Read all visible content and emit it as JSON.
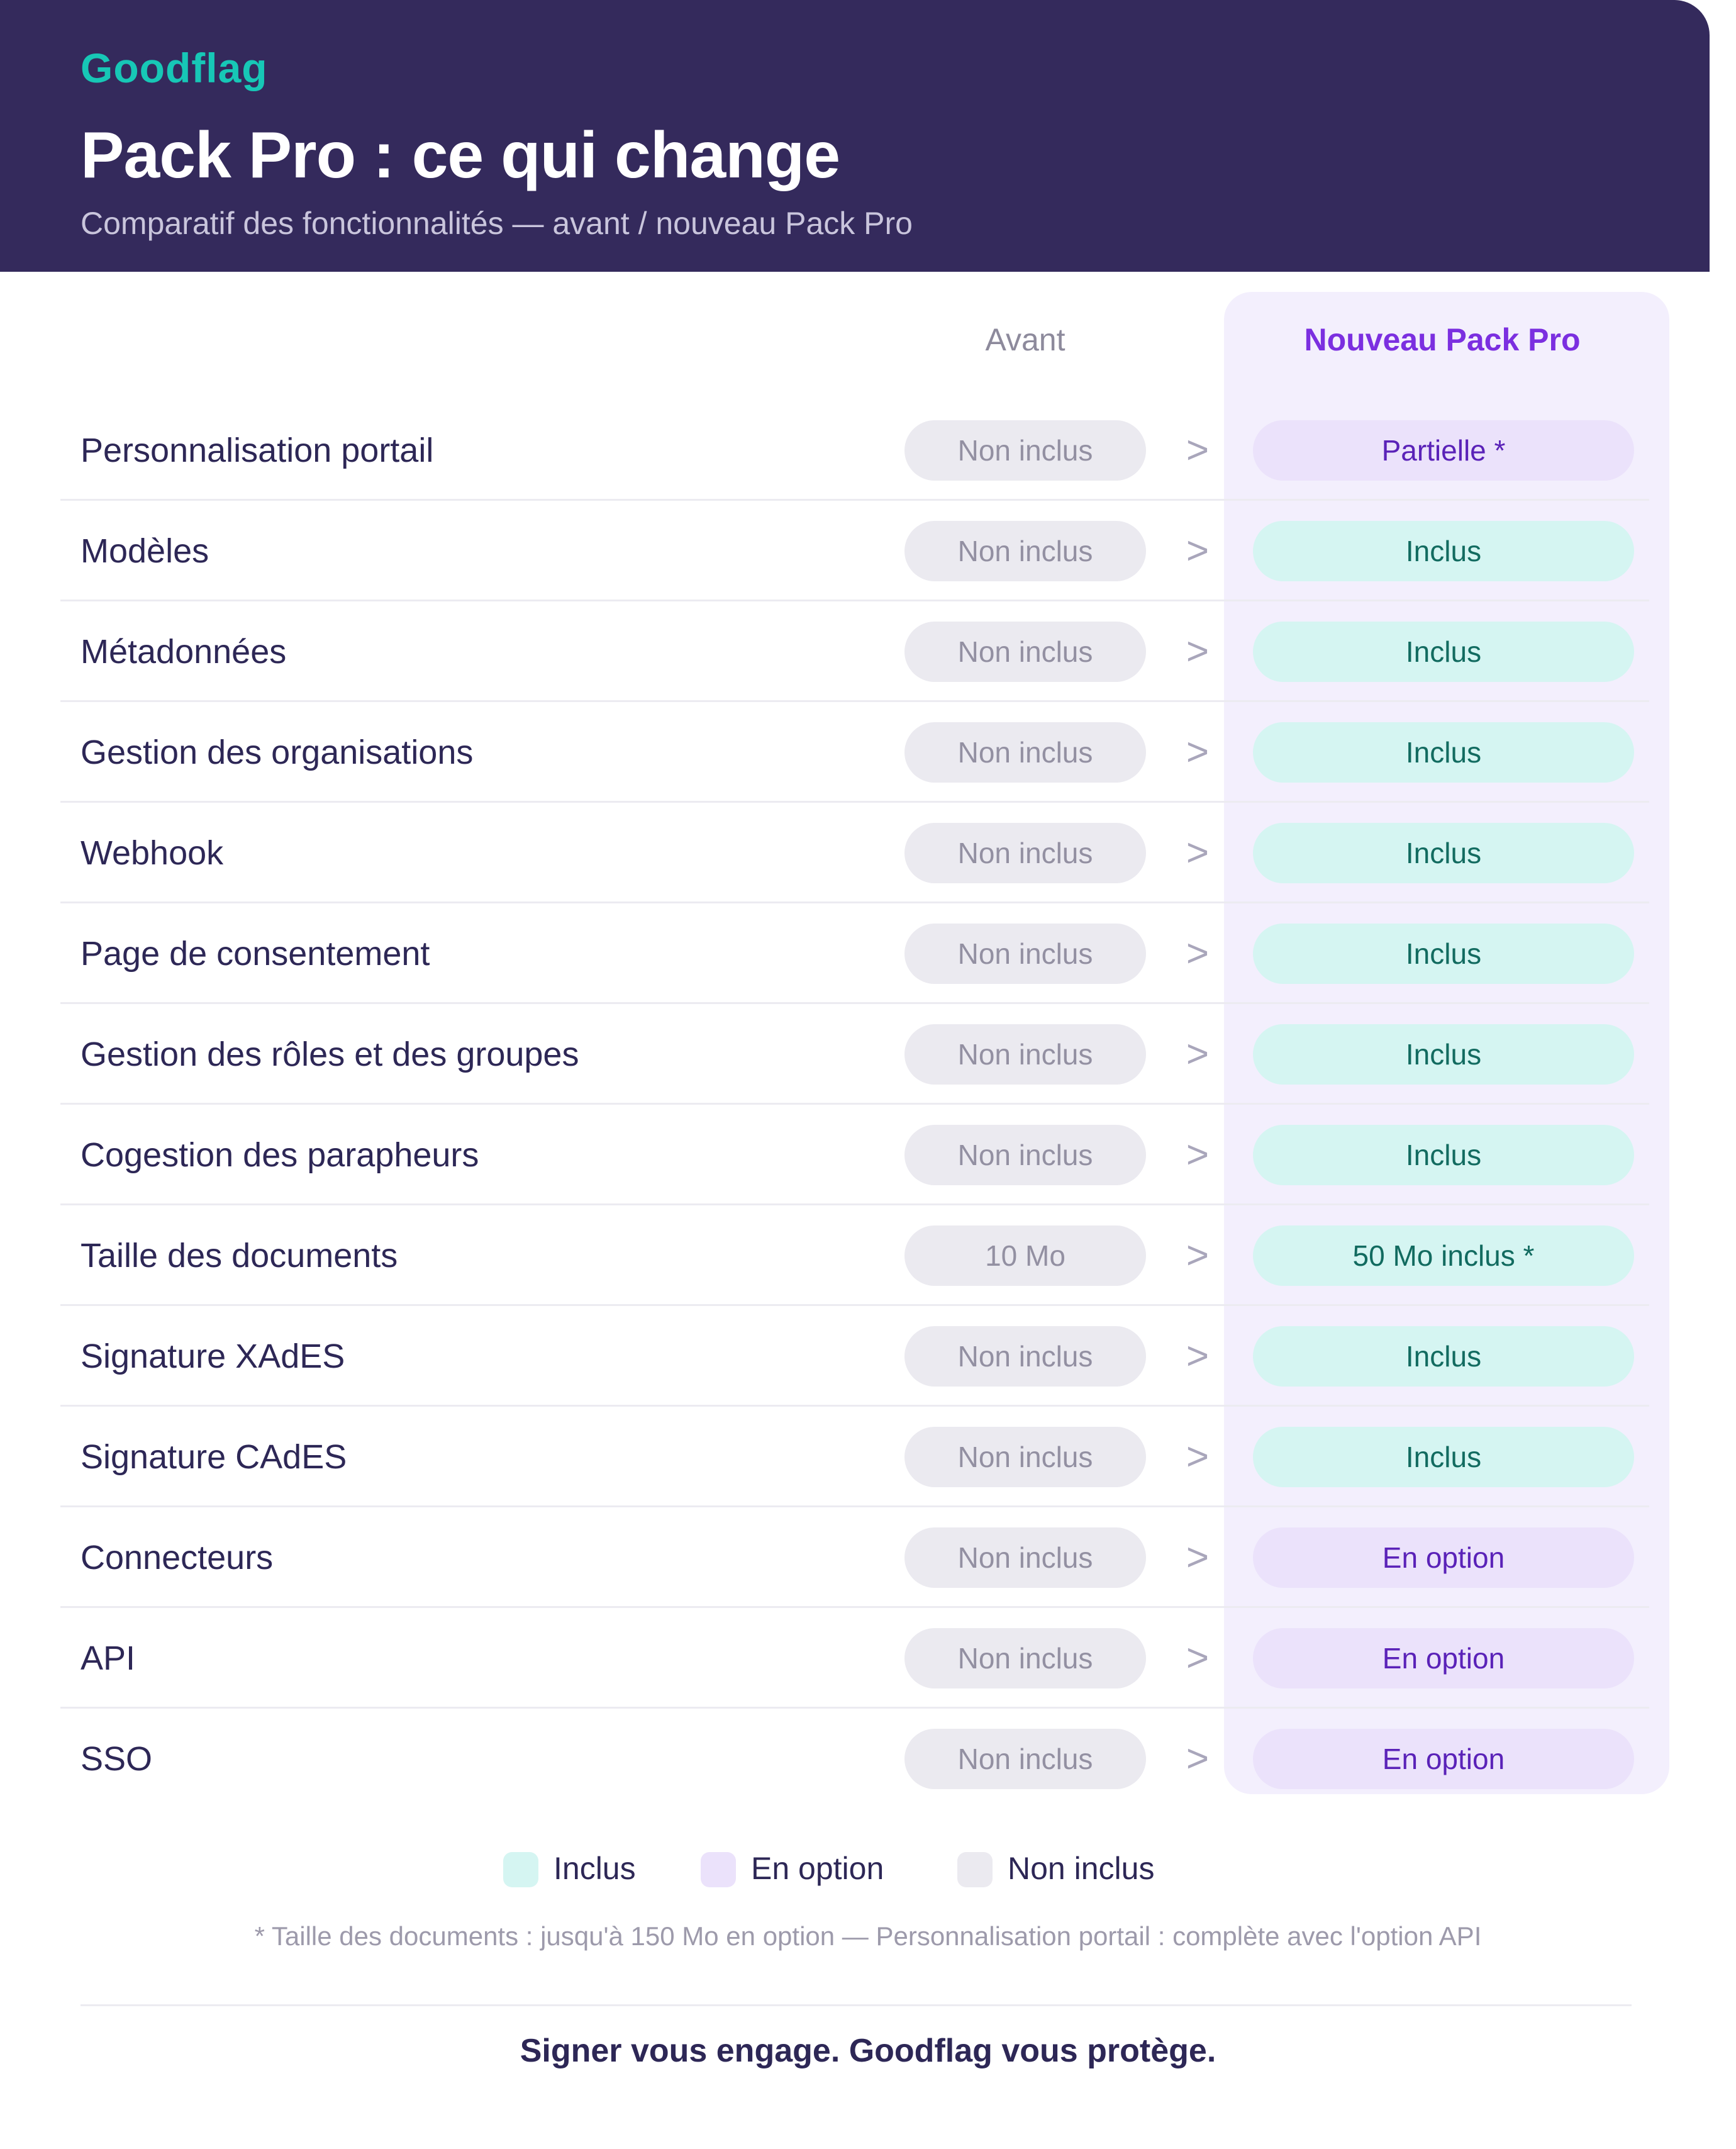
{
  "header": {
    "brand": "Goodflag",
    "title": "Pack Pro : ce qui change",
    "subtitle": "Comparatif des fonctionnalités — avant / nouveau Pack Pro"
  },
  "columns": {
    "avant": "Avant",
    "nouveau": "Nouveau Pack Pro"
  },
  "arrow": ">",
  "rows": [
    {
      "feature": "Personnalisation portail",
      "before": "Non inclus",
      "after": "Partielle *",
      "after_status": "option"
    },
    {
      "feature": "Modèles",
      "before": "Non inclus",
      "after": "Inclus",
      "after_status": "inclus"
    },
    {
      "feature": "Métadonnées",
      "before": "Non inclus",
      "after": "Inclus",
      "after_status": "inclus"
    },
    {
      "feature": "Gestion des organisations",
      "before": "Non inclus",
      "after": "Inclus",
      "after_status": "inclus"
    },
    {
      "feature": "Webhook",
      "before": "Non inclus",
      "after": "Inclus",
      "after_status": "inclus"
    },
    {
      "feature": "Page de consentement",
      "before": "Non inclus",
      "after": "Inclus",
      "after_status": "inclus"
    },
    {
      "feature": "Gestion des rôles et des groupes",
      "before": "Non inclus",
      "after": "Inclus",
      "after_status": "inclus"
    },
    {
      "feature": "Cogestion des parapheurs",
      "before": "Non inclus",
      "after": "Inclus",
      "after_status": "inclus"
    },
    {
      "feature": "Taille des documents",
      "before": "10 Mo",
      "after": "50 Mo inclus *",
      "after_status": "inclus"
    },
    {
      "feature": "Signature XAdES",
      "before": "Non inclus",
      "after": "Inclus",
      "after_status": "inclus"
    },
    {
      "feature": "Signature CAdES",
      "before": "Non inclus",
      "after": "Inclus",
      "after_status": "inclus"
    },
    {
      "feature": "Connecteurs",
      "before": "Non inclus",
      "after": "En option",
      "after_status": "option"
    },
    {
      "feature": "API",
      "before": "Non inclus",
      "after": "En option",
      "after_status": "option"
    },
    {
      "feature": "SSO",
      "before": "Non inclus",
      "after": "En option",
      "after_status": "option"
    }
  ],
  "legend": {
    "inclus": "Inclus",
    "option": "En option",
    "non_inclus": "Non inclus"
  },
  "footnote": "* Taille des documents : jusqu'à 150 Mo en option — Personnalisation portail : complète avec l'option API",
  "tagline": "Signer vous engage. Goodflag vous protège.",
  "colors": {
    "header_bg": "#342a5c",
    "brand": "#17c7b6",
    "accent_purple": "#7b2fe0",
    "inclus_bg": "#d5f5f2",
    "option_bg": "#ebe2fb",
    "non_inclus_bg": "#ebeaf0",
    "highlight_col": "#f3effd"
  }
}
